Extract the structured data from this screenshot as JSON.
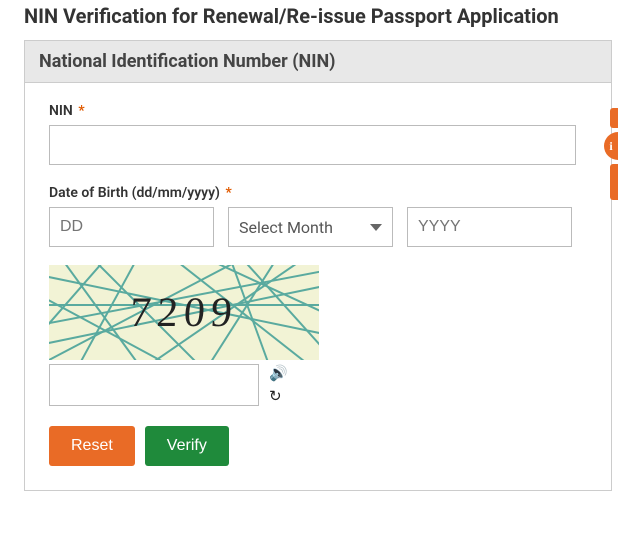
{
  "page": {
    "title": "NIN Verification for Renewal/Re-issue Passport Application",
    "panel_header": "National Identification Number (NIN)"
  },
  "form": {
    "nin": {
      "label": "NIN",
      "required_mark": "*",
      "value": ""
    },
    "dob": {
      "label": "Date of Birth (dd/mm/yyyy)",
      "required_mark": "*",
      "dd_placeholder": "DD",
      "month_placeholder": "Select Month",
      "yyyy_placeholder": "YYYY"
    },
    "captcha": {
      "code": "7209",
      "input_value": ""
    },
    "buttons": {
      "reset": "Reset",
      "verify": "Verify"
    }
  },
  "side": {
    "info_glyph": "i"
  }
}
